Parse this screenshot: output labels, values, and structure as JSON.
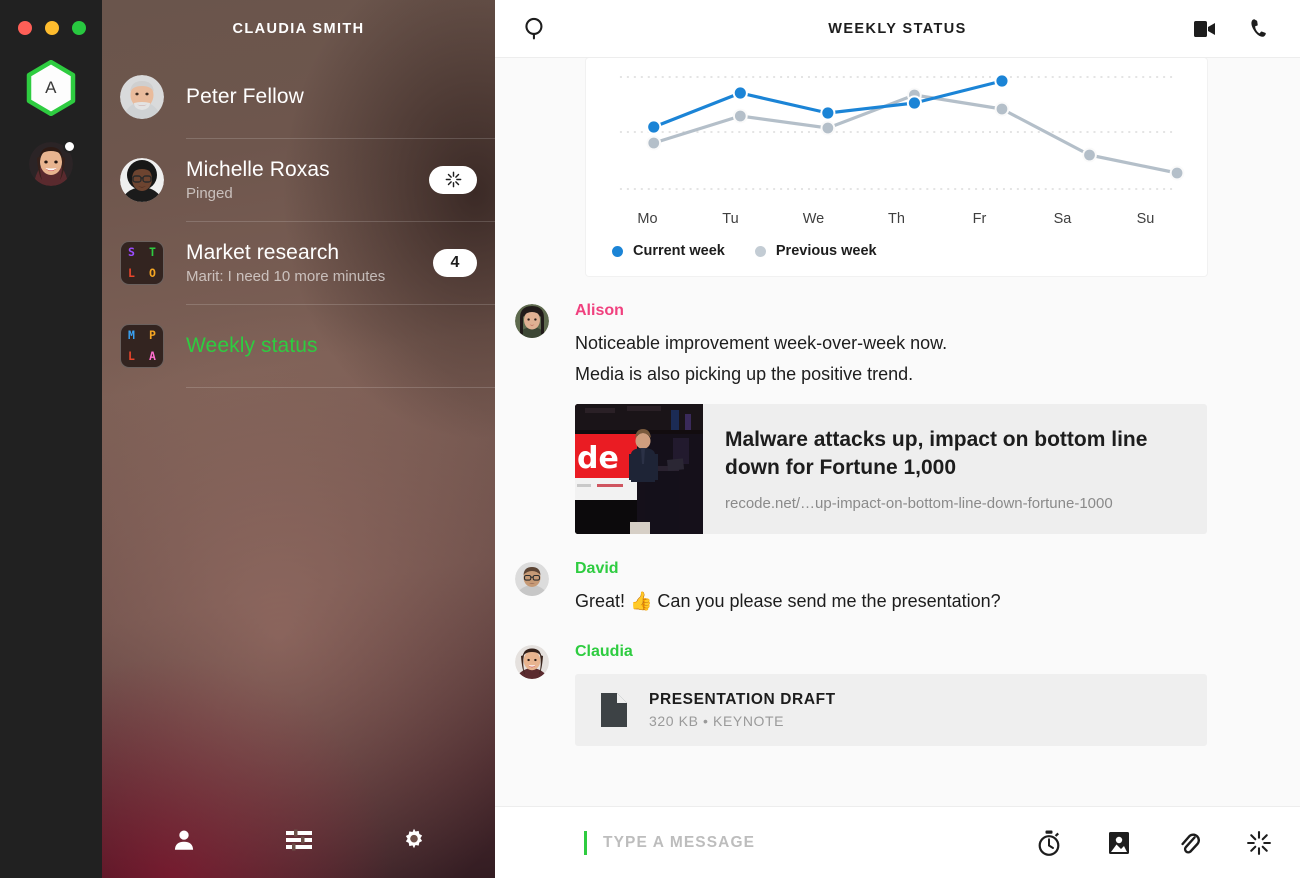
{
  "window": {
    "traffic_lights": [
      {
        "name": "close-button",
        "color": "#ff5f57"
      },
      {
        "name": "minimize-button",
        "color": "#febc2e"
      },
      {
        "name": "zoom-button",
        "color": "#28c840"
      }
    ]
  },
  "rail": {
    "team_badge": {
      "letter": "A",
      "ring_color": "#2ecc40",
      "name": "team-hexagon-badge"
    },
    "account_avatar": {
      "name": "account-avatar",
      "has_unread_dot": true
    }
  },
  "sidebar": {
    "title": "CLAUDIA SMITH",
    "conversations": [
      {
        "name": "Peter Fellow",
        "subtitle": "",
        "avatar_type": "photo",
        "badge": null,
        "active": false
      },
      {
        "name": "Michelle Roxas",
        "subtitle": "Pinged",
        "avatar_type": "photo",
        "badge": {
          "type": "ping",
          "label": ""
        },
        "active": false
      },
      {
        "name": "Market research",
        "subtitle": "Marit: I need 10 more minutes",
        "avatar_type": "tile",
        "tile_letters": [
          {
            "ch": "S",
            "color": "#9b4dff"
          },
          {
            "ch": "T",
            "color": "#2ecc40"
          },
          {
            "ch": "L",
            "color": "#e8452c"
          },
          {
            "ch": "O",
            "color": "#f5a623"
          }
        ],
        "badge": {
          "type": "count",
          "label": "4"
        },
        "active": false
      },
      {
        "name": "Weekly status",
        "subtitle": "",
        "avatar_type": "tile",
        "tile_letters": [
          {
            "ch": "M",
            "color": "#3aa3f5"
          },
          {
            "ch": "P",
            "color": "#f5a623"
          },
          {
            "ch": "L",
            "color": "#e8452c"
          },
          {
            "ch": "A",
            "color": "#ff6fcf"
          }
        ],
        "badge": null,
        "active": true,
        "active_color": "#2ecc40"
      }
    ],
    "nav": [
      {
        "name": "contacts-nav-icon",
        "icon": "person-icon"
      },
      {
        "name": "filters-nav-icon",
        "icon": "sliders-icon"
      },
      {
        "name": "settings-nav-icon",
        "icon": "gear-icon"
      }
    ]
  },
  "header": {
    "search_icon": "search-icon",
    "title": "WEEKLY STATUS",
    "video_icon": "video-camera-icon",
    "call_icon": "phone-icon"
  },
  "chart_data": {
    "type": "line",
    "title": "",
    "xlabel": "",
    "ylabel": "",
    "categories": [
      "Mo",
      "Tu",
      "We",
      "Th",
      "Fr",
      "Sa",
      "Su"
    ],
    "grid": true,
    "gridlines_y": [
      73,
      128,
      185
    ],
    "legend_position": "bottom-left",
    "series": [
      {
        "name": "Current week",
        "color": "#1b84d6",
        "values": [
          121,
          88,
          107,
          96,
          76,
          null,
          null
        ]
      },
      {
        "name": "Previous week",
        "color": "#b4bfc9",
        "values": [
          136,
          111,
          121,
          86,
          103,
          150,
          167
        ]
      }
    ],
    "note": "values are screen y-positions of markers; lower y = higher value"
  },
  "messages": [
    {
      "author": "Alison",
      "author_color": "#f0407e",
      "avatar": "alison-avatar",
      "lines": [
        "Noticeable improvement week-over-week now.",
        "Media is also picking up the positive trend."
      ],
      "attachment": {
        "kind": "link-preview",
        "title": "Malware attacks up, impact on bottom line down for Fortune 1,000",
        "url": "recode.net/…up-impact-on-bottom-line-down-fortune-1000"
      }
    },
    {
      "author": "David",
      "author_color": "#2ecc40",
      "avatar": "david-avatar",
      "lines": [
        "Great! 👍 Can you please send me the presentation?"
      ],
      "attachment": null
    },
    {
      "author": "Claudia",
      "author_color": "#2ecc40",
      "avatar": "claudia-avatar",
      "lines": [],
      "attachment": {
        "kind": "file",
        "filename": "PRESENTATION DRAFT",
        "filemeta": "320 KB • KEYNOTE",
        "icon": "document-icon"
      }
    }
  ],
  "composer": {
    "placeholder": "TYPE A MESSAGE",
    "value": "",
    "caret_color": "#2ecc40",
    "actions": [
      {
        "name": "timer-button",
        "icon": "stopwatch-icon"
      },
      {
        "name": "image-button",
        "icon": "image-icon"
      },
      {
        "name": "attach-button",
        "icon": "paperclip-icon"
      },
      {
        "name": "ping-button",
        "icon": "ping-sparkle-icon"
      }
    ]
  }
}
